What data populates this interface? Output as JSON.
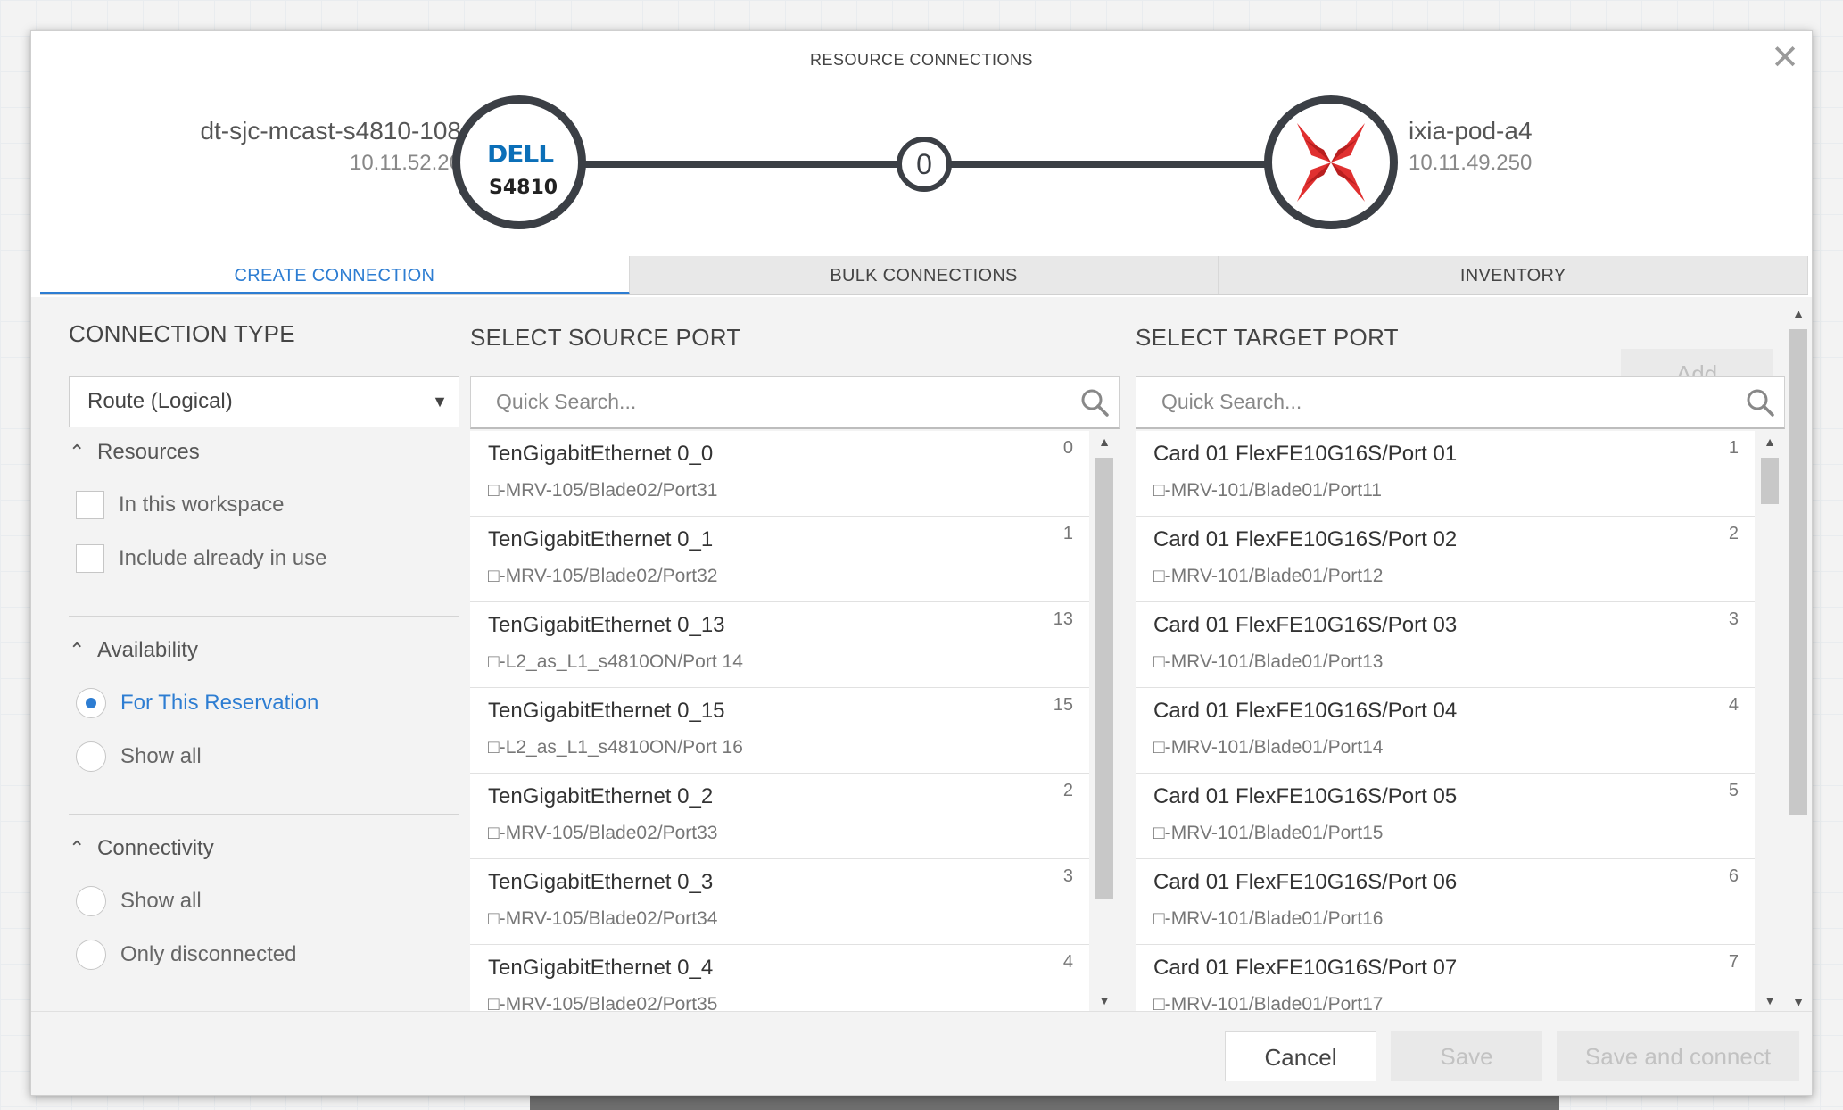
{
  "dialog": {
    "title": "RESOURCE CONNECTIONS"
  },
  "source_device": {
    "name": "dt-sjc-mcast-s4810-108",
    "ip": "10.11.52.20",
    "logo_text": "DELL",
    "model": "S4810"
  },
  "target_device": {
    "name": "ixia-pod-a4",
    "ip": "10.11.49.250"
  },
  "connection_count": "0",
  "tabs": [
    {
      "label": "CREATE CONNECTION",
      "active": true
    },
    {
      "label": "BULK CONNECTIONS",
      "active": false
    },
    {
      "label": "INVENTORY",
      "active": false
    }
  ],
  "filters": {
    "connection_type_heading": "CONNECTION TYPE",
    "connection_type_value": "Route (Logical)",
    "resources": {
      "label": "Resources",
      "options": [
        "In this workspace",
        "Include already in use"
      ]
    },
    "availability": {
      "label": "Availability",
      "options": [
        "For This Reservation",
        "Show all"
      ],
      "selected": "For This Reservation"
    },
    "connectivity": {
      "label": "Connectivity",
      "options": [
        "Show all",
        "Only disconnected"
      ]
    }
  },
  "source_port": {
    "heading": "SELECT SOURCE PORT",
    "search_placeholder": "Quick Search...",
    "ports": [
      {
        "name": "TenGigabitEthernet 0_0",
        "conn": "MRV-105/Blade02/Port31",
        "num": "0"
      },
      {
        "name": "TenGigabitEthernet 0_1",
        "conn": "MRV-105/Blade02/Port32",
        "num": "1"
      },
      {
        "name": "TenGigabitEthernet 0_13",
        "conn": "L2_as_L1_s4810ON/Port 14",
        "num": "13"
      },
      {
        "name": "TenGigabitEthernet 0_15",
        "conn": "L2_as_L1_s4810ON/Port 16",
        "num": "15"
      },
      {
        "name": "TenGigabitEthernet 0_2",
        "conn": "MRV-105/Blade02/Port33",
        "num": "2"
      },
      {
        "name": "TenGigabitEthernet 0_3",
        "conn": "MRV-105/Blade02/Port34",
        "num": "3"
      },
      {
        "name": "TenGigabitEthernet 0_4",
        "conn": "MRV-105/Blade02/Port35",
        "num": "4"
      }
    ]
  },
  "target_port": {
    "heading": "SELECT TARGET PORT",
    "search_placeholder": "Quick Search...",
    "add_label": "Add",
    "ports": [
      {
        "name": "Card 01 FlexFE10G16S/Port 01",
        "conn": "MRV-101/Blade01/Port11",
        "num": "1"
      },
      {
        "name": "Card 01 FlexFE10G16S/Port 02",
        "conn": "MRV-101/Blade01/Port12",
        "num": "2"
      },
      {
        "name": "Card 01 FlexFE10G16S/Port 03",
        "conn": "MRV-101/Blade01/Port13",
        "num": "3"
      },
      {
        "name": "Card 01 FlexFE10G16S/Port 04",
        "conn": "MRV-101/Blade01/Port14",
        "num": "4"
      },
      {
        "name": "Card 01 FlexFE10G16S/Port 05",
        "conn": "MRV-101/Blade01/Port15",
        "num": "5"
      },
      {
        "name": "Card 01 FlexFE10G16S/Port 06",
        "conn": "MRV-101/Blade01/Port16",
        "num": "6"
      },
      {
        "name": "Card 01 FlexFE10G16S/Port 07",
        "conn": "MRV-101/Blade01/Port17",
        "num": "7"
      }
    ]
  },
  "footer": {
    "cancel_label": "Cancel",
    "save_label": "Save",
    "save_connect_label": "Save and connect"
  },
  "icons": {
    "close": "close-icon",
    "search": "search-icon",
    "collapse": "chevron-up-icon",
    "dropdown": "caret-down-icon",
    "link": "connector-icon",
    "ixia_logo": "ixia-logo-icon"
  },
  "colors": {
    "accent": "#2d7dd2",
    "ring": "#3b3f45",
    "dell_blue": "#0b6fb8",
    "ixia_red": "#e03030"
  }
}
